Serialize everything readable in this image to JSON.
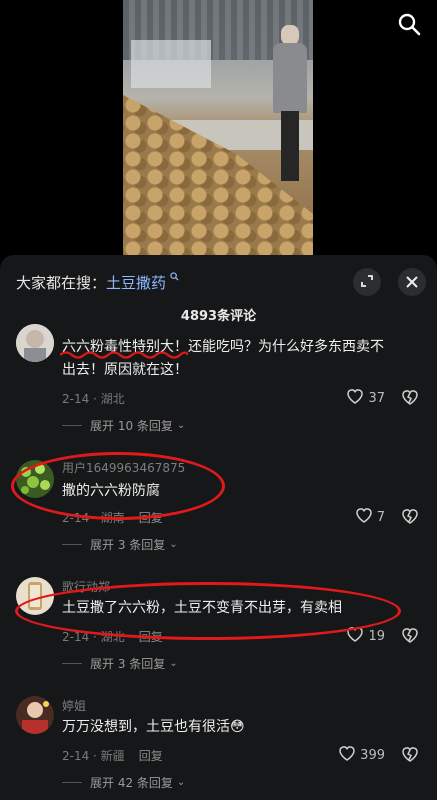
{
  "video": {
    "search_icon": "search-icon"
  },
  "header": {
    "search_prefix": "大家都在搜：",
    "search_term": "土豆撒药",
    "count_label": "4893条评论"
  },
  "comments": [
    {
      "user": "",
      "text_marked": "六六粉毒性特别大！",
      "text_rest": "还能吃吗？为什么好多东西卖不出去！原因就在这！",
      "date": "2-14 · 湖北",
      "likes": "37",
      "replies": "展开 10 条回复"
    },
    {
      "user": "用户1649963467875",
      "text": "撒的六六粉防腐",
      "date": "2-14 · 湖南",
      "reply": "回复",
      "likes": "7",
      "replies": "展开 3 条回复"
    },
    {
      "user": "歌行动郑",
      "text": "土豆撒了六六粉，土豆不变青不出芽，有卖相",
      "date": "2-14 · 湖北",
      "reply": "回复",
      "likes": "19",
      "replies": "展开 3 条回复"
    },
    {
      "user": "婷姐",
      "text": "万万没想到，土豆也有很活",
      "emoji": "😳",
      "date": "2-14 · 新疆",
      "reply": "回复",
      "likes": "399",
      "replies": "展开 42 条回复"
    }
  ],
  "colors": {
    "sheet_bg": "#161718",
    "link": "#8fb8ff",
    "annotation": "#e0191b"
  }
}
